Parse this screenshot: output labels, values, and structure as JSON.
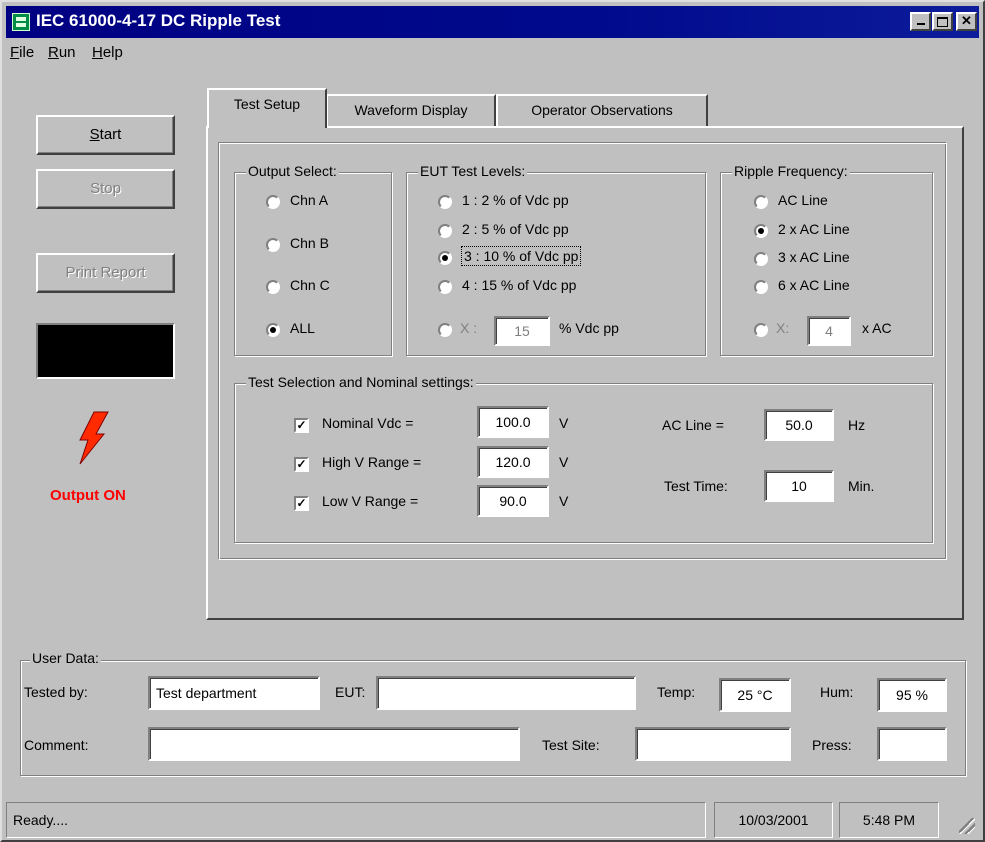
{
  "window": {
    "title": "IEC 61000-4-17 DC Ripple Test"
  },
  "menu": [
    {
      "label": "File",
      "mnemonic": "F",
      "rest": "ile"
    },
    {
      "label": "Run",
      "mnemonic": "R",
      "rest": "un"
    },
    {
      "label": "Help",
      "mnemonic": "H",
      "rest": "elp"
    }
  ],
  "left": {
    "start_first": "S",
    "start_rest": "tart",
    "stop_label": "Stop",
    "print_label": "Print Report",
    "output_status": "Output ON"
  },
  "tabs": [
    "Test Setup",
    "Waveform Display",
    "Operator Observations"
  ],
  "output_select": {
    "title": "Output Select:",
    "options": [
      "Chn A",
      "Chn B",
      "Chn C",
      "ALL"
    ],
    "selected": "ALL"
  },
  "eut_levels": {
    "title": "EUT Test Levels:",
    "options": [
      "1 : 2 % of Vdc pp",
      "2 : 5 % of Vdc pp",
      "3 : 10 % of Vdc pp",
      "4 : 15 % of Vdc pp"
    ],
    "selected": "3 : 10 % of Vdc pp",
    "custom_label": "X :",
    "custom_value": "15",
    "custom_unit": "% Vdc pp"
  },
  "ripple_freq": {
    "title": "Ripple Frequency:",
    "options": [
      "AC Line",
      "2 x AC Line",
      "3 x AC Line",
      "6 x AC Line"
    ],
    "selected": "2 x AC Line",
    "custom_label": "X:",
    "custom_value": "4",
    "custom_unit": "x AC"
  },
  "test_selection": {
    "title": "Test Selection and Nominal settings:",
    "nominal_label": "Nominal Vdc =",
    "nominal_value": "100.0",
    "nominal_unit": "V",
    "high_label": "High V Range =",
    "high_value": "120.0",
    "high_unit": "V",
    "low_label": "Low V Range =",
    "low_value": "90.0",
    "low_unit": "V",
    "ac_line_label": "AC Line =",
    "ac_line_value": "50.0",
    "ac_line_unit": "Hz",
    "test_time_label": "Test Time:",
    "test_time_value": "10",
    "test_time_unit": "Min."
  },
  "user_data": {
    "title": "User Data:",
    "tested_by_label": "Tested by:",
    "tested_by_value": "Test department",
    "eut_label": "EUT:",
    "eut_value": "",
    "temp_label": "Temp:",
    "temp_value": "25 °C",
    "hum_label": "Hum:",
    "hum_value": "95 %",
    "comment_label": "Comment:",
    "comment_value": "",
    "site_label": "Test Site:",
    "site_value": "",
    "press_label": "Press:",
    "press_value": ""
  },
  "status": {
    "message": "Ready....",
    "date": "10/03/2001",
    "time": "5:48 PM"
  }
}
